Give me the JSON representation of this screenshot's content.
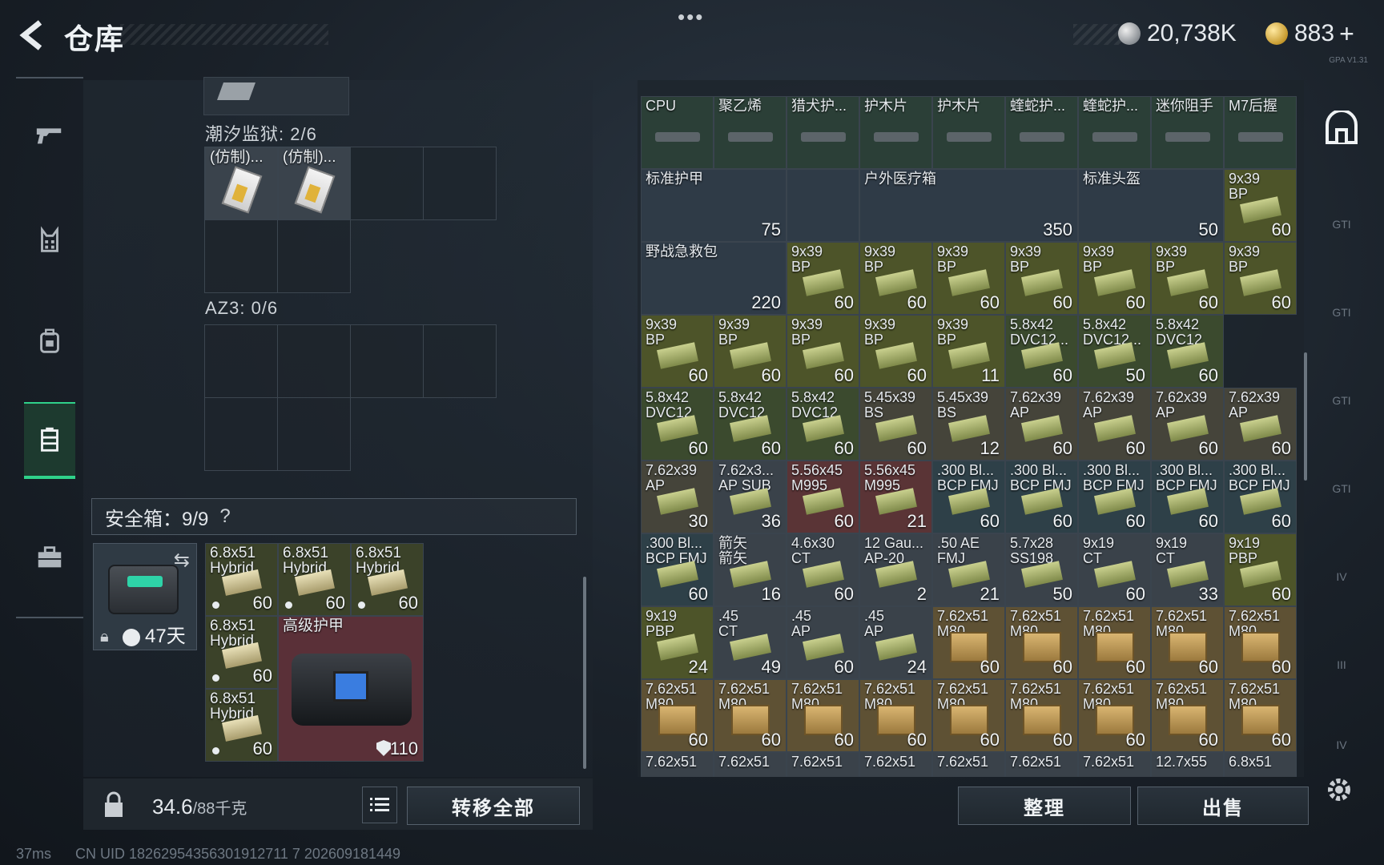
{
  "header": {
    "title": "仓库",
    "more": "•••",
    "currency1": "20,738K",
    "currency2": "883",
    "plus": "+",
    "version": "GPA V1.31"
  },
  "stash": {
    "sections": [
      {
        "label": "潮汐监狱: 2/6"
      },
      {
        "label": "AZ3: 0/6"
      }
    ],
    "tidal_items": [
      {
        "name": "(仿制)..."
      },
      {
        "name": "(仿制)..."
      }
    ],
    "safe_box": {
      "label": "安全箱：9/9",
      "help": "?",
      "days": "47天"
    },
    "safe_items": [
      {
        "name": "6.8x51\nHybrid",
        "count": "60"
      },
      {
        "name": "6.8x51\nHybrid",
        "count": "60"
      },
      {
        "name": "6.8x51\nHybrid",
        "count": "60"
      },
      {
        "name": "6.8x51\nHybrid",
        "count": "60"
      },
      {
        "name": "6.8x51\nHybrid",
        "count": "60"
      }
    ],
    "armor": {
      "name": "高级护甲",
      "value": "110"
    }
  },
  "footer": {
    "weight": "34.6",
    "weight_cap": "/88千克",
    "transfer_all": "转移全部",
    "sort": "整理",
    "sell": "出售"
  },
  "inventory": {
    "row1": [
      {
        "name": "CPU",
        "count": ""
      },
      {
        "name": "聚乙烯",
        "count": ""
      },
      {
        "name": "猎犬护...",
        "count": ""
      },
      {
        "name": "护木片",
        "count": ""
      },
      {
        "name": "护木片",
        "count": ""
      },
      {
        "name": "蝰蛇护...",
        "count": ""
      },
      {
        "name": "蝰蛇护...",
        "count": ""
      },
      {
        "name": "迷你阻手",
        "count": ""
      },
      {
        "name": "M7后握",
        "count": ""
      }
    ],
    "big": [
      {
        "name": "标准护甲",
        "value": "75"
      },
      {
        "name": "户外医疗箱",
        "value": "350"
      },
      {
        "name": "标准头盔",
        "value": "50"
      },
      {
        "name": "野战急救包",
        "value": "220"
      }
    ],
    "row2_last": {
      "name": "9x39\nBP",
      "count": "60"
    },
    "row3": [
      {
        "name": "9x39\nBP",
        "count": "60"
      },
      {
        "name": "9x39\nBP",
        "count": "60"
      },
      {
        "name": "9x39\nBP",
        "count": "60"
      },
      {
        "name": "9x39\nBP",
        "count": "60"
      },
      {
        "name": "9x39\nBP",
        "count": "60"
      },
      {
        "name": "9x39\nBP",
        "count": "60"
      },
      {
        "name": "9x39\nBP",
        "count": "60"
      }
    ],
    "rows": [
      [
        {
          "name": "9x39\nBP",
          "count": "60"
        },
        {
          "name": "9x39\nBP",
          "count": "60"
        },
        {
          "name": "9x39\nBP",
          "count": "60"
        },
        {
          "name": "9x39\nBP",
          "count": "60"
        },
        {
          "name": "9x39\nBP",
          "count": "11"
        },
        {
          "name": "5.8x42\nDVC12...",
          "count": "60"
        },
        {
          "name": "5.8x42\nDVC12...",
          "count": "50"
        },
        {
          "name": "5.8x42\nDVC12",
          "count": "60"
        }
      ],
      [
        {
          "name": "5.8x42\nDVC12",
          "count": "60"
        },
        {
          "name": "5.8x42\nDVC12",
          "count": "60"
        },
        {
          "name": "5.8x42\nDVC12",
          "count": "60"
        },
        {
          "name": "5.45x39\nBS",
          "count": "60"
        },
        {
          "name": "5.45x39\nBS",
          "count": "12"
        },
        {
          "name": "7.62x39\nAP",
          "count": "60"
        },
        {
          "name": "7.62x39\nAP",
          "count": "60"
        },
        {
          "name": "7.62x39\nAP",
          "count": "60"
        },
        {
          "name": "7.62x39\nAP",
          "count": "60"
        }
      ],
      [
        {
          "name": "7.62x39\nAP",
          "count": "30"
        },
        {
          "name": "7.62x3...\nAP SUB",
          "count": "36"
        },
        {
          "name": "5.56x45\nM995",
          "count": "60"
        },
        {
          "name": "5.56x45\nM995",
          "count": "21"
        },
        {
          "name": ".300 Bl...\nBCP FMJ",
          "count": "60"
        },
        {
          "name": ".300 Bl...\nBCP FMJ",
          "count": "60"
        },
        {
          "name": ".300 Bl...\nBCP FMJ",
          "count": "60"
        },
        {
          "name": ".300 Bl...\nBCP FMJ",
          "count": "60"
        },
        {
          "name": ".300 Bl...\nBCP FMJ",
          "count": "60"
        }
      ],
      [
        {
          "name": ".300 Bl...\nBCP FMJ",
          "count": "60"
        },
        {
          "name": "箭矢\n箭矢",
          "count": "16"
        },
        {
          "name": "4.6x30\nCT",
          "count": "60"
        },
        {
          "name": "12 Gau...\nAP-20",
          "count": "2"
        },
        {
          "name": ".50 AE\nFMJ",
          "count": "21"
        },
        {
          "name": "5.7x28\nSS198",
          "count": "50"
        },
        {
          "name": "9x19\nCT",
          "count": "60"
        },
        {
          "name": "9x19\nCT",
          "count": "33"
        },
        {
          "name": "9x19\nPBP",
          "count": "60"
        }
      ],
      [
        {
          "name": "9x19\nPBP",
          "count": "24"
        },
        {
          "name": ".45\nCT",
          "count": "49"
        },
        {
          "name": ".45\nAP",
          "count": "60"
        },
        {
          "name": ".45\nAP",
          "count": "24"
        },
        {
          "name": "7.62x51\nM80",
          "count": "60"
        },
        {
          "name": "7.62x51\nM80",
          "count": "60"
        },
        {
          "name": "7.62x51\nM80",
          "count": "60"
        },
        {
          "name": "7.62x51\nM80",
          "count": "60"
        },
        {
          "name": "7.62x51\nM80",
          "count": "60"
        }
      ],
      [
        {
          "name": "7.62x51\nM80",
          "count": "60"
        },
        {
          "name": "7.62x51\nM80",
          "count": "60"
        },
        {
          "name": "7.62x51\nM80",
          "count": "60"
        },
        {
          "name": "7.62x51\nM80",
          "count": "60"
        },
        {
          "name": "7.62x51\nM80",
          "count": "60"
        },
        {
          "name": "7.62x51\nM80",
          "count": "60"
        },
        {
          "name": "7.62x51\nM80",
          "count": "60"
        },
        {
          "name": "7.62x51\nM80",
          "count": "60"
        },
        {
          "name": "7.62x51\nM80",
          "count": "60"
        }
      ],
      [
        {
          "name": "7.62x51",
          "count": ""
        },
        {
          "name": "7.62x51",
          "count": ""
        },
        {
          "name": "7.62x51",
          "count": ""
        },
        {
          "name": "7.62x51",
          "count": ""
        },
        {
          "name": "7.62x51",
          "count": ""
        },
        {
          "name": "7.62x51",
          "count": ""
        },
        {
          "name": "7.62x51",
          "count": ""
        },
        {
          "name": "12.7x55",
          "count": ""
        },
        {
          "name": "6.8x51",
          "count": ""
        }
      ]
    ]
  },
  "right_nav": [
    "GTI",
    "GTI",
    "GTI",
    "GTI",
    "IV",
    "III",
    "IV"
  ],
  "status": {
    "ping": "37ms",
    "uid": "CN UID 18262954356301912711 7 202609181449"
  }
}
